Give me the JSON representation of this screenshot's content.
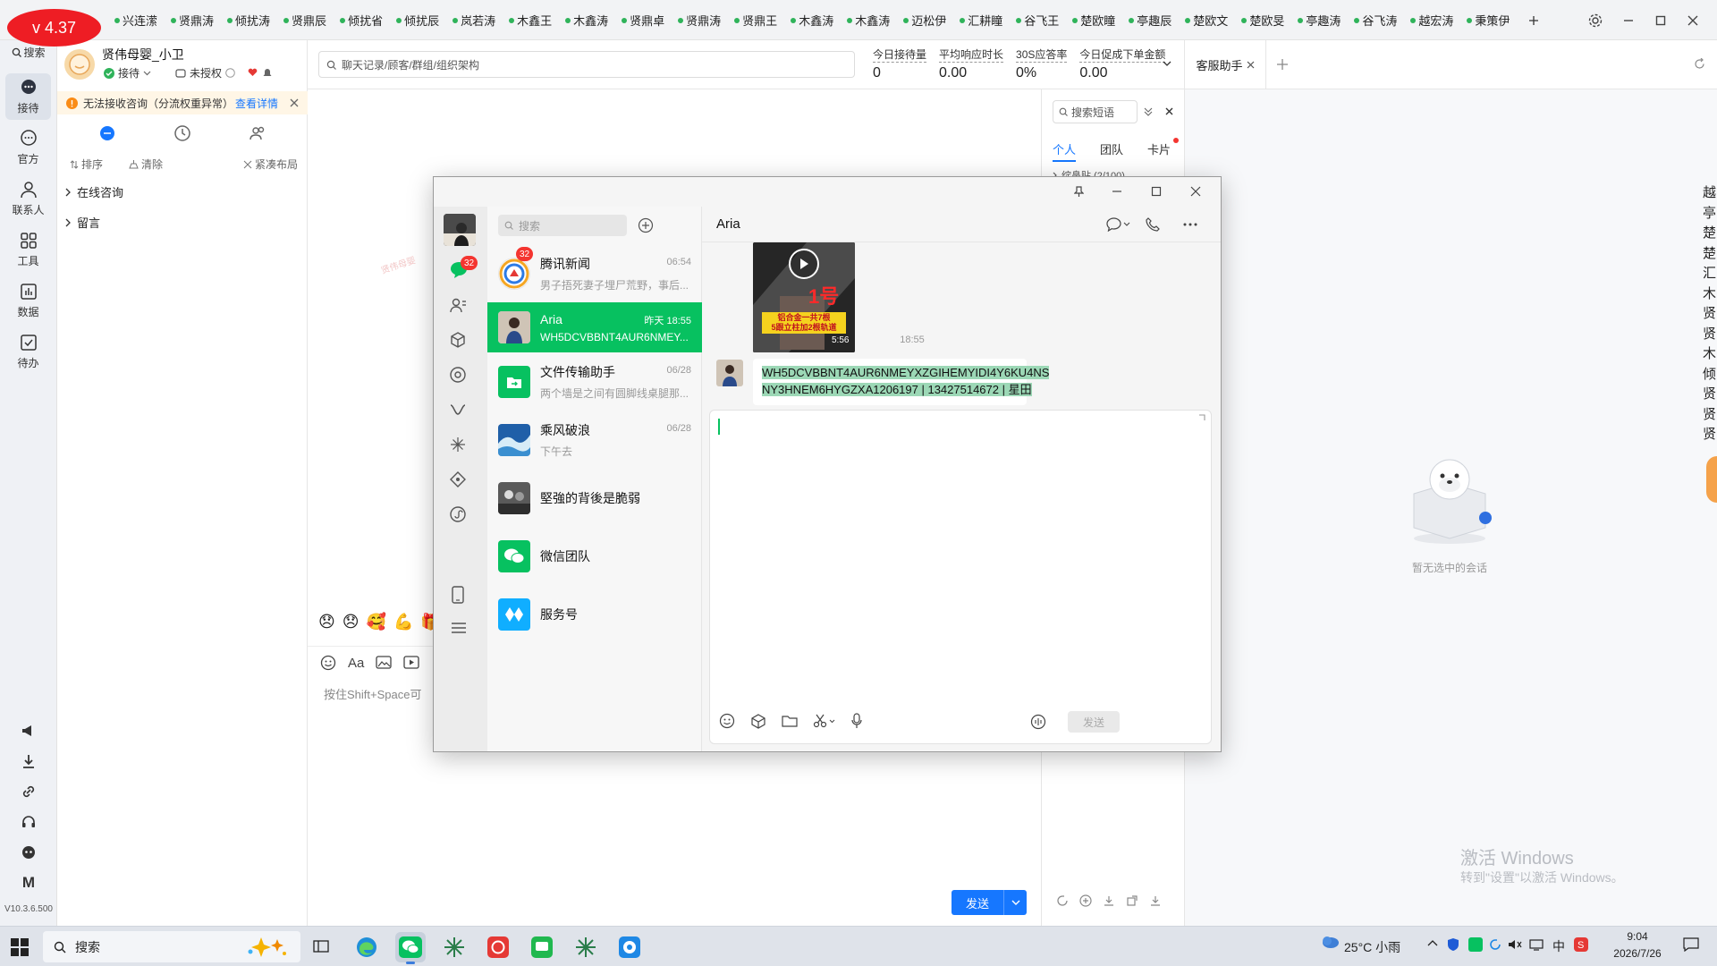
{
  "version_badge": "v 4.37",
  "top_tabs": [
    "兴连潆",
    "贤鼎涛",
    "倾扰涛",
    "贤鼎辰",
    "倾扰省",
    "倾扰辰",
    "岚若涛",
    "木鑫王",
    "木鑫涛",
    "贤鼎卓",
    "贤鼎涛",
    "贤鼎王",
    "木鑫涛",
    "木鑫涛",
    "迈松伊",
    "汇耕瞳",
    "谷飞王",
    "楚欧瞳",
    "亭趣辰",
    "楚欧文",
    "楚欧旻",
    "亭趣涛",
    "谷飞涛",
    "越宏涛",
    "秉策伊"
  ],
  "rail": {
    "search": "搜索",
    "items": [
      "接待",
      "官方",
      "联系人",
      "工具",
      "数据",
      "待办"
    ],
    "version": "V10.3.6.500"
  },
  "agent": {
    "name": "贤伟母婴_小卫",
    "status": "接待",
    "auth": "未授权"
  },
  "warning": {
    "text": "无法接收咨询（分流权重异常）",
    "link": "查看详情"
  },
  "list_tools": {
    "sort": "排序",
    "clear": "清除",
    "layout": "紧凑布局"
  },
  "groups": [
    "在线咨询",
    "留言"
  ],
  "search_placeholder": "聊天记录/顾客/群组/组织架构",
  "metrics": [
    {
      "label": "今日接待量",
      "value": "0"
    },
    {
      "label": "平均响应时长",
      "value": "0.00"
    },
    {
      "label": "30S应答率",
      "value": "0%"
    },
    {
      "label": "今日促成下单金额",
      "value": "0.00"
    }
  ],
  "assistant_tab": "客服助手",
  "quick": {
    "search_placeholder": "搜索短语",
    "tabs": [
      "个人",
      "团队",
      "卡片"
    ],
    "group": "绽鼻贴 (2/100)"
  },
  "input_hint": "按住Shift+Space可",
  "send_button": "发送",
  "empty_state": "暂无选中的会话",
  "activate": {
    "title": "激活 Windows",
    "sub": "转到\"设置\"以激活 Windows。"
  },
  "right_edge_chars": [
    "越",
    "亭",
    "楚",
    "楚",
    "汇",
    "木",
    "贤",
    "贤",
    "木",
    "倾",
    "贤",
    "贤",
    "贤"
  ],
  "wechat": {
    "search_placeholder": "搜索",
    "nav_badge": "32",
    "conversations": [
      {
        "name": "腾讯新闻",
        "preview": "男子捂死妻子埋尸荒野，事后...",
        "time": "06:54",
        "badge": "32"
      },
      {
        "name": "Aria",
        "preview": "WH5DCVBBNT4AUR6NMEY...",
        "time": "昨天 18:55",
        "badge": ""
      },
      {
        "name": "文件传输助手",
        "preview": "两个墙是之间有圆脚线桌腿那...",
        "time": "06/28",
        "badge": ""
      },
      {
        "name": "乘风破浪",
        "preview": "下午去",
        "time": "06/28",
        "badge": ""
      },
      {
        "name": "堅強的背後是脆弱",
        "preview": "",
        "time": "",
        "badge": ""
      },
      {
        "name": "微信团队",
        "preview": "",
        "time": "",
        "badge": ""
      },
      {
        "name": "服务号",
        "preview": "",
        "time": "",
        "badge": ""
      }
    ],
    "chat_title": "Aria",
    "video": {
      "big_label": "1号",
      "caption_line1": "铝合金一共7根",
      "caption_line2": "5跟立柱加2根轨道",
      "duration": "5:56"
    },
    "time_divider": "18:55",
    "message_line1": "WH5DCVBBNT4AUR6NMEYXZGIHEMYIDI4Y6KU4NS",
    "message_line2": "NY3HNEM6HYGZXA1206197 | 13427514672 | 星田",
    "send_label": "发送"
  },
  "taskbar": {
    "search": "搜索",
    "weather": "25°C 小雨",
    "ime": "中",
    "time": "9:04",
    "date": "2026/7/26"
  },
  "colors": {
    "accent": "#07c160",
    "primary": "#1677ff",
    "badge_red": "#ee1d24"
  }
}
